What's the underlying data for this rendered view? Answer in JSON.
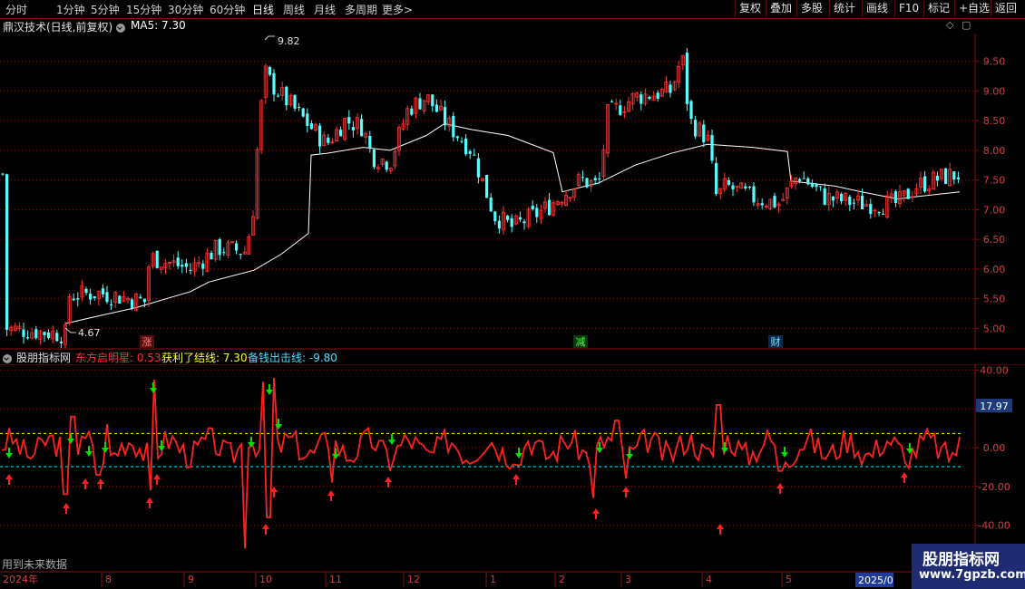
{
  "toolbar": {
    "periods": [
      "分时",
      "1分钟",
      "5分钟",
      "15分钟",
      "30分钟",
      "60分钟",
      "日线",
      "周线",
      "月线",
      "多周期",
      "更多"
    ],
    "active_period": "日线",
    "more_chevron": ">",
    "buttons": [
      "复权",
      "叠加",
      "多股",
      "统计",
      "画线",
      "F10",
      "标记",
      "+自选",
      "返回"
    ]
  },
  "main": {
    "stock_title": "鼎汉技术(日线,前复权)",
    "ma_label": "MA5: 7.30",
    "high_label": "9.82",
    "low_label": "4.67",
    "price_ticks": [
      "9.50",
      "9.00",
      "8.50",
      "8.00",
      "7.50",
      "7.00",
      "6.50",
      "6.00",
      "5.50",
      "5.00"
    ],
    "event_markers": [
      {
        "text": "涨",
        "color": "#ff8080",
        "bg": "#5a0a0a"
      },
      {
        "text": "减",
        "color": "#40ff40",
        "bg": "#0a3a0a"
      },
      {
        "text": "财",
        "color": "#80e0ff",
        "bg": "#0a2a4a"
      }
    ],
    "colors": {
      "up": "#ff3232",
      "down": "#54ffff",
      "ma": "#ffffff",
      "grid": "#7a1010"
    }
  },
  "indicator": {
    "name": "股朋指标网",
    "line1": "东方启明星: 0.53",
    "line2": "获利了结线: 7.30",
    "line3": "备钱出击线: -9.80",
    "right_badge": "17.97",
    "ticks": [
      "40.00",
      "20.00",
      "0.00",
      "-20.00",
      "-40.00"
    ],
    "colors": {
      "main": "#ff2020",
      "take_profit": "#ffff00",
      "buy_line": "#00ffff",
      "up_arrow": "#ff2020",
      "down_arrow": "#00e000"
    },
    "note": "用到未来数据"
  },
  "timeline": {
    "year_start": "2024年",
    "months": [
      "8",
      "9",
      "10",
      "11",
      "12",
      "1",
      "2",
      "3",
      "4",
      "5"
    ],
    "year_end": "2025/0"
  },
  "watermark": {
    "title": "股朋指标网",
    "url": "www.7gpzb.com"
  }
}
